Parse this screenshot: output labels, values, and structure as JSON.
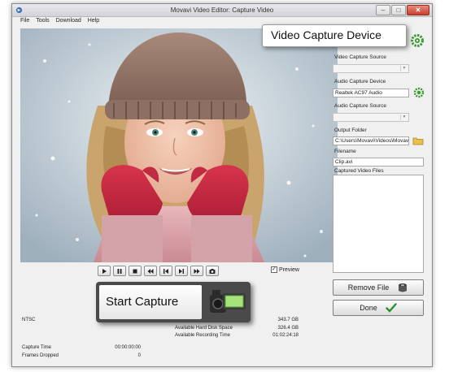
{
  "window": {
    "title": "Movavi Video Editor: Capture Video"
  },
  "menu": [
    "File",
    "Tools",
    "Download",
    "Help"
  ],
  "sidebar": {
    "video_source_label": "Video Capture Source",
    "video_source_value": "",
    "audio_device_label": "Audio Capture Device",
    "audio_device_value": "Realtek AC97 Audio",
    "audio_source_label": "Audio Capture Source",
    "audio_source_value": "",
    "output_folder_label": "Output Folder",
    "output_folder_value": "C:\\Users\\Movavi\\Videos\\Movavi",
    "filename_label": "Filename",
    "filename_value": "Clip.avi",
    "captured_files_label": "Captured Video Files"
  },
  "buttons": {
    "remove_file": "Remove File",
    "done": "Done"
  },
  "preview": {
    "label": "Preview",
    "checked": true
  },
  "stats": {
    "format": "NTSC",
    "total_label": "",
    "total_value": "343.7 GB",
    "free_label": "Available Hard Disk Space",
    "free_value": "326.4 GB",
    "recording_label": "Available Recording Time",
    "recording_value": "01:02:24:18",
    "capture_time_label": "Capture Time",
    "capture_time_value": "00:00:00:00",
    "frames_dropped_label": "Frames Dropped",
    "frames_dropped_value": "0"
  },
  "callouts": {
    "device": "Video Capture Device",
    "start": "Start Capture"
  },
  "colors": {
    "accent_green": "#2f8f2f",
    "gear_green": "#3a9a2e",
    "callout_dark": "#4a4a4a"
  }
}
